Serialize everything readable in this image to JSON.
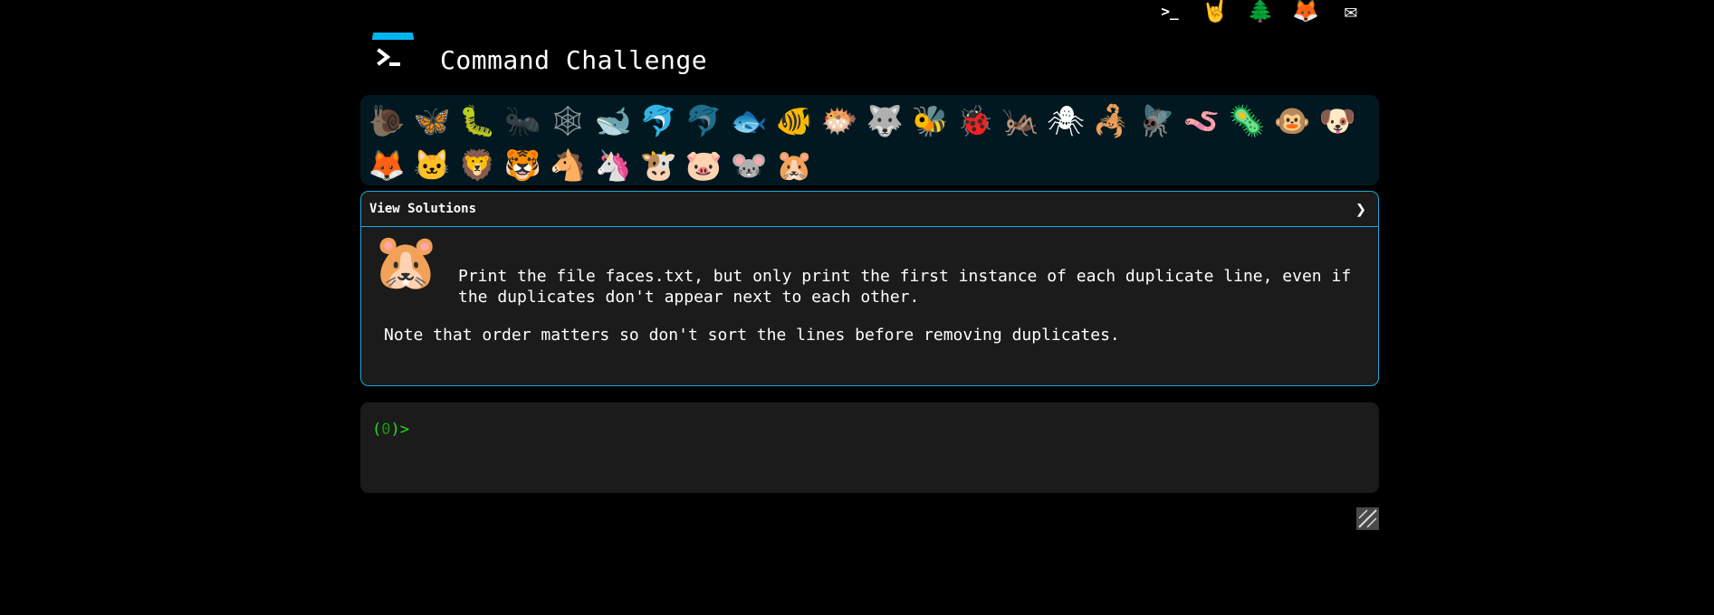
{
  "top_icons": [
    {
      "name": "terminal-link-icon",
      "glyph": ">_"
    },
    {
      "name": "rock-hand-icon",
      "glyph": "🤘"
    },
    {
      "name": "tree-icon",
      "glyph": "🌲"
    },
    {
      "name": "gitlab-icon",
      "glyph": "🦊"
    },
    {
      "name": "mail-icon",
      "glyph": "✉"
    }
  ],
  "header": {
    "title": "Command Challenge"
  },
  "animals": [
    {
      "name": "snail",
      "glyph": "🐌",
      "dim": true
    },
    {
      "name": "butterfly",
      "glyph": "🦋",
      "dim": false
    },
    {
      "name": "bug",
      "glyph": "🐛",
      "dim": false
    },
    {
      "name": "ant",
      "glyph": "🐜",
      "dim": true
    },
    {
      "name": "spider-web",
      "glyph": "🕸",
      "dim": true
    },
    {
      "name": "whale",
      "glyph": "🐋",
      "dim": false
    },
    {
      "name": "dolphin",
      "glyph": "🐬",
      "dim": false
    },
    {
      "name": "shark",
      "glyph": "🐬",
      "dim": true
    },
    {
      "name": "fish",
      "glyph": "🐟",
      "dim": false
    },
    {
      "name": "tropical-fish",
      "glyph": "🐠",
      "dim": false
    },
    {
      "name": "pufferfish",
      "glyph": "🐡",
      "dim": false
    },
    {
      "name": "wolf",
      "glyph": "🐺",
      "dim": false
    },
    {
      "name": "bee",
      "glyph": "🐝",
      "dim": false
    },
    {
      "name": "ladybug",
      "glyph": "🐞",
      "dim": false
    },
    {
      "name": "cricket",
      "glyph": "🦗",
      "dim": false
    },
    {
      "name": "spider",
      "glyph": "🕷",
      "dim": false
    },
    {
      "name": "scorpion",
      "glyph": "🦂",
      "dim": false
    },
    {
      "name": "fly",
      "glyph": "🪰",
      "dim": false
    },
    {
      "name": "worm",
      "glyph": "🪱",
      "dim": false
    },
    {
      "name": "microbe",
      "glyph": "🦠",
      "dim": false
    },
    {
      "name": "monkey",
      "glyph": "🐵",
      "dim": false
    },
    {
      "name": "dog",
      "glyph": "🐶",
      "dim": false
    },
    {
      "name": "fox",
      "glyph": "🦊",
      "dim": false
    },
    {
      "name": "cat",
      "glyph": "🐱",
      "dim": false
    },
    {
      "name": "lion",
      "glyph": "🦁",
      "dim": false
    },
    {
      "name": "tiger",
      "glyph": "🐯",
      "dim": false
    },
    {
      "name": "horse",
      "glyph": "🐴",
      "dim": false
    },
    {
      "name": "unicorn",
      "glyph": "🦄",
      "dim": false
    },
    {
      "name": "cow",
      "glyph": "🐮",
      "dim": false
    },
    {
      "name": "pig",
      "glyph": "🐷",
      "dim": false
    },
    {
      "name": "mouse",
      "glyph": "🐭",
      "dim": false
    },
    {
      "name": "hamster",
      "glyph": "🐹",
      "dim": false
    }
  ],
  "panel": {
    "header_label": "View Solutions",
    "chevron": "❯",
    "face_glyph": "🐹",
    "challenge_text": "Print the file faces.txt, but only print the first instance of each duplicate line, even if the duplicates don't appear next to each other.",
    "note_text": "Note that order matters so don't sort the lines before removing duplicates."
  },
  "terminal": {
    "prompt_open": "(",
    "prompt_count": "0",
    "prompt_close": ")>"
  },
  "colors": {
    "accent": "#1aa7d4",
    "prompt": "#22dd22",
    "logo_blue": "#00b4f0"
  }
}
